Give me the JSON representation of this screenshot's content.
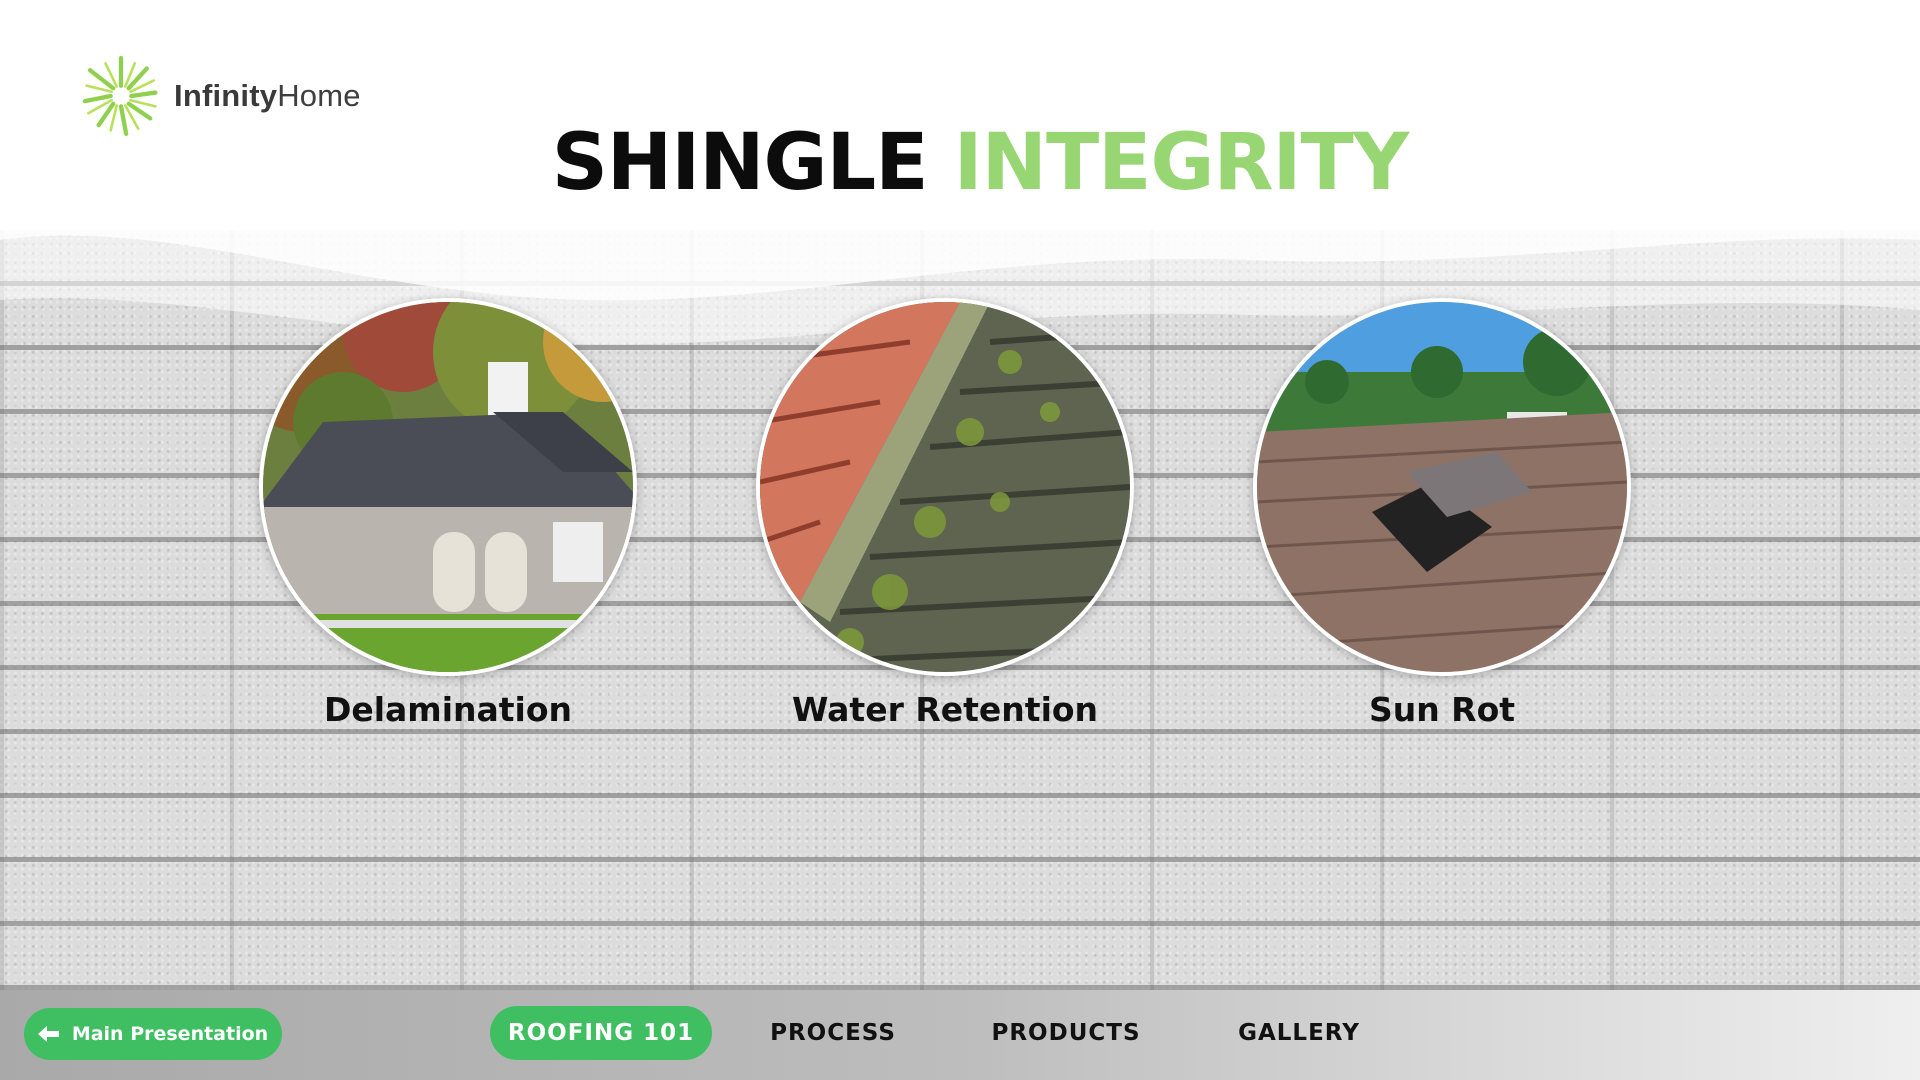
{
  "logo": {
    "brand_bold": "Infinity",
    "brand_light": "Home",
    "icon": "starburst-logo-icon",
    "color": "#8fd14f"
  },
  "title": {
    "word1": "SHINGLE",
    "word2": "INTEGRITY",
    "accent_color": "#97d672"
  },
  "cards": [
    {
      "label": "Delamination",
      "image": "house-roof-photo"
    },
    {
      "label": "Water Retention",
      "image": "moss-covered-roof-photo"
    },
    {
      "label": "Sun Rot",
      "image": "damaged-shingle-photo"
    }
  ],
  "nav": {
    "back_label": "Main Presentation",
    "back_icon": "arrow-left-icon",
    "items": [
      {
        "label": "ROOFING 101",
        "active": true
      },
      {
        "label": "PROCESS",
        "active": false
      },
      {
        "label": "PRODUCTS",
        "active": false
      },
      {
        "label": "GALLERY",
        "active": false
      }
    ],
    "accent_color": "#3fbf62"
  }
}
